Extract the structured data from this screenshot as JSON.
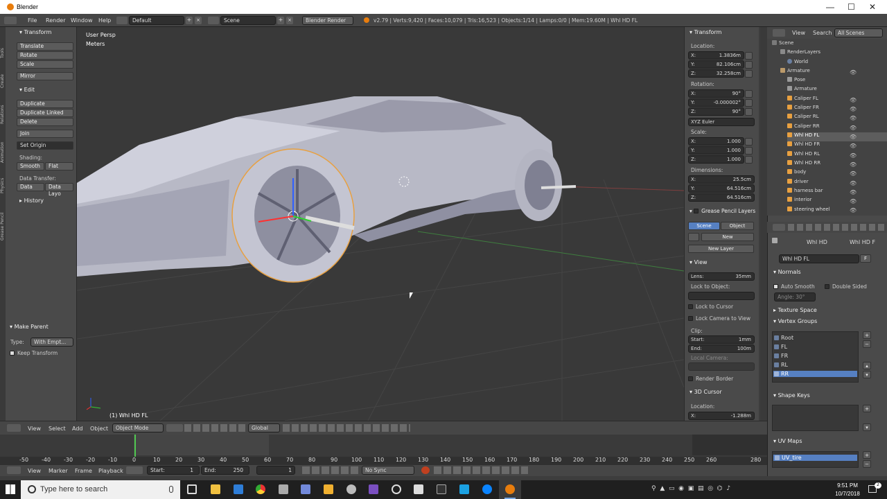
{
  "window": {
    "title": "Blender",
    "minimize": "—",
    "maximize": "☐",
    "close": "✕"
  },
  "infobar": {
    "menus": [
      "File",
      "Render",
      "Window",
      "Help"
    ],
    "layout": "Default",
    "scene": "Scene",
    "engine": "Blender Render",
    "stats": "v2.79 | Verts:9,420 | Faces:10,079 | Tris:16,523 | Objects:1/14 | Lamps:0/0 | Mem:19.60M | Whl HD FL"
  },
  "toolshelf": {
    "tabs": [
      "Tools",
      "Create",
      "Relations",
      "Animation",
      "Physics",
      "Grease Pencil"
    ],
    "transform_header": "Transform",
    "transform_buttons": [
      "Translate",
      "Rotate",
      "Scale"
    ],
    "mirror": "Mirror",
    "edit_header": "Edit",
    "edit_buttons": [
      "Duplicate",
      "Duplicate Linked",
      "Delete"
    ],
    "join": "Join",
    "set_origin": "Set Origin",
    "shading_label": "Shading:",
    "smooth": "Smooth",
    "flat": "Flat",
    "data_transfer_label": "Data Transfer:",
    "data": "Data",
    "data_layo": "Data Layo",
    "history": "History",
    "make_parent": "Make Parent",
    "type_label": "Type:",
    "type_value": "With Empt...",
    "keep_transform": "Keep Transform"
  },
  "viewport": {
    "view_name": "User Persp",
    "units": "Meters",
    "object_label": "(1) Whl HD FL"
  },
  "properties": {
    "transform_header": "Transform",
    "location_label": "Location:",
    "location": [
      {
        "axis": "X:",
        "value": "1.3836m"
      },
      {
        "axis": "Y:",
        "value": "82.106cm"
      },
      {
        "axis": "Z:",
        "value": "32.258cm"
      }
    ],
    "rotation_label": "Rotation:",
    "rotation": [
      {
        "axis": "X:",
        "value": "90°"
      },
      {
        "axis": "Y:",
        "value": "-0.000002°"
      },
      {
        "axis": "Z:",
        "value": "90°"
      }
    ],
    "rotation_mode": "XYZ Euler",
    "scale_label": "Scale:",
    "scale": [
      {
        "axis": "X:",
        "value": "1.000"
      },
      {
        "axis": "Y:",
        "value": "1.000"
      },
      {
        "axis": "Z:",
        "value": "1.000"
      }
    ],
    "dimensions_label": "Dimensions:",
    "dimensions": [
      {
        "axis": "X:",
        "value": "25.5cm"
      },
      {
        "axis": "Y:",
        "value": "64.516cm"
      },
      {
        "axis": "Z:",
        "value": "64.516cm"
      }
    ],
    "gp_header": "Grease Pencil Layers",
    "gp_scene": "Scene",
    "gp_object": "Object",
    "gp_new": "New",
    "gp_new_layer": "New Layer",
    "view_header": "View",
    "lens_label": "Lens:",
    "lens_value": "35mm",
    "lock_to_object": "Lock to Object:",
    "lock_to_cursor": "Lock to Cursor",
    "lock_camera": "Lock Camera to View",
    "clip_label": "Clip:",
    "clip_start_label": "Start:",
    "clip_start": "1mm",
    "clip_end_label": "End:",
    "clip_end": "100m",
    "local_camera": "Local Camera:",
    "render_border": "Render Border",
    "cursor_header": "3D Cursor",
    "cursor_location_label": "Location:",
    "cursor_x_label": "X:",
    "cursor_x": "-1.288m"
  },
  "outliner": {
    "view": "View",
    "search": "Search",
    "filter": "All Scenes",
    "rows": [
      "Scene",
      "RenderLayers",
      "World",
      "Armature",
      "Pose",
      "Armature",
      "Caliper FL",
      "Caliper FR",
      "Caliper RL",
      "Caliper RR",
      "Whl HD FL",
      "Whl HD FR",
      "Whl HD RL",
      "Whl HD RR",
      "body",
      "driver",
      "harness bar",
      "interior",
      "steering wheel"
    ]
  },
  "data_panel": {
    "crumb1": "Whl HD",
    "crumb2": "Whl HD F",
    "mesh_name": "Whl HD FL",
    "f_button": "F",
    "normals": "Normals",
    "auto_smooth": "Auto Smooth",
    "double_sided": "Double Sided",
    "angle": "Angle:   30°",
    "texture_space": "Texture Space",
    "vertex_groups": "Vertex Groups",
    "groups": [
      "Root",
      "FL",
      "FR",
      "RL",
      "RR"
    ],
    "shape_keys": "Shape Keys",
    "uv_maps": "UV Maps",
    "uv_name": "UV_tire"
  },
  "view3d_header": {
    "menus": [
      "View",
      "Select",
      "Add",
      "Object"
    ],
    "mode": "Object Mode",
    "orientation": "Global"
  },
  "timeline": {
    "ticks": [
      "-50",
      "-40",
      "-30",
      "-20",
      "-10",
      "0",
      "10",
      "20",
      "30",
      "40",
      "50",
      "60",
      "70",
      "80",
      "90",
      "100",
      "110",
      "120",
      "130",
      "140",
      "150",
      "160",
      "170",
      "180",
      "190",
      "200",
      "210",
      "220",
      "230",
      "240",
      "250",
      "260",
      "280"
    ],
    "menus": [
      "View",
      "Marker",
      "Frame",
      "Playback"
    ],
    "start_label": "Start:",
    "start": "1",
    "end_label": "End:",
    "end": "250",
    "current": "1",
    "sync": "No Sync"
  },
  "taskbar": {
    "search_placeholder": "Type here to search",
    "time": "9:51 PM",
    "date": "10/7/2018",
    "notifications": "2"
  },
  "colors": {
    "accent": "#5680c2",
    "blender_orange": "#e87d0d",
    "selection_outline": "#e8a040"
  }
}
